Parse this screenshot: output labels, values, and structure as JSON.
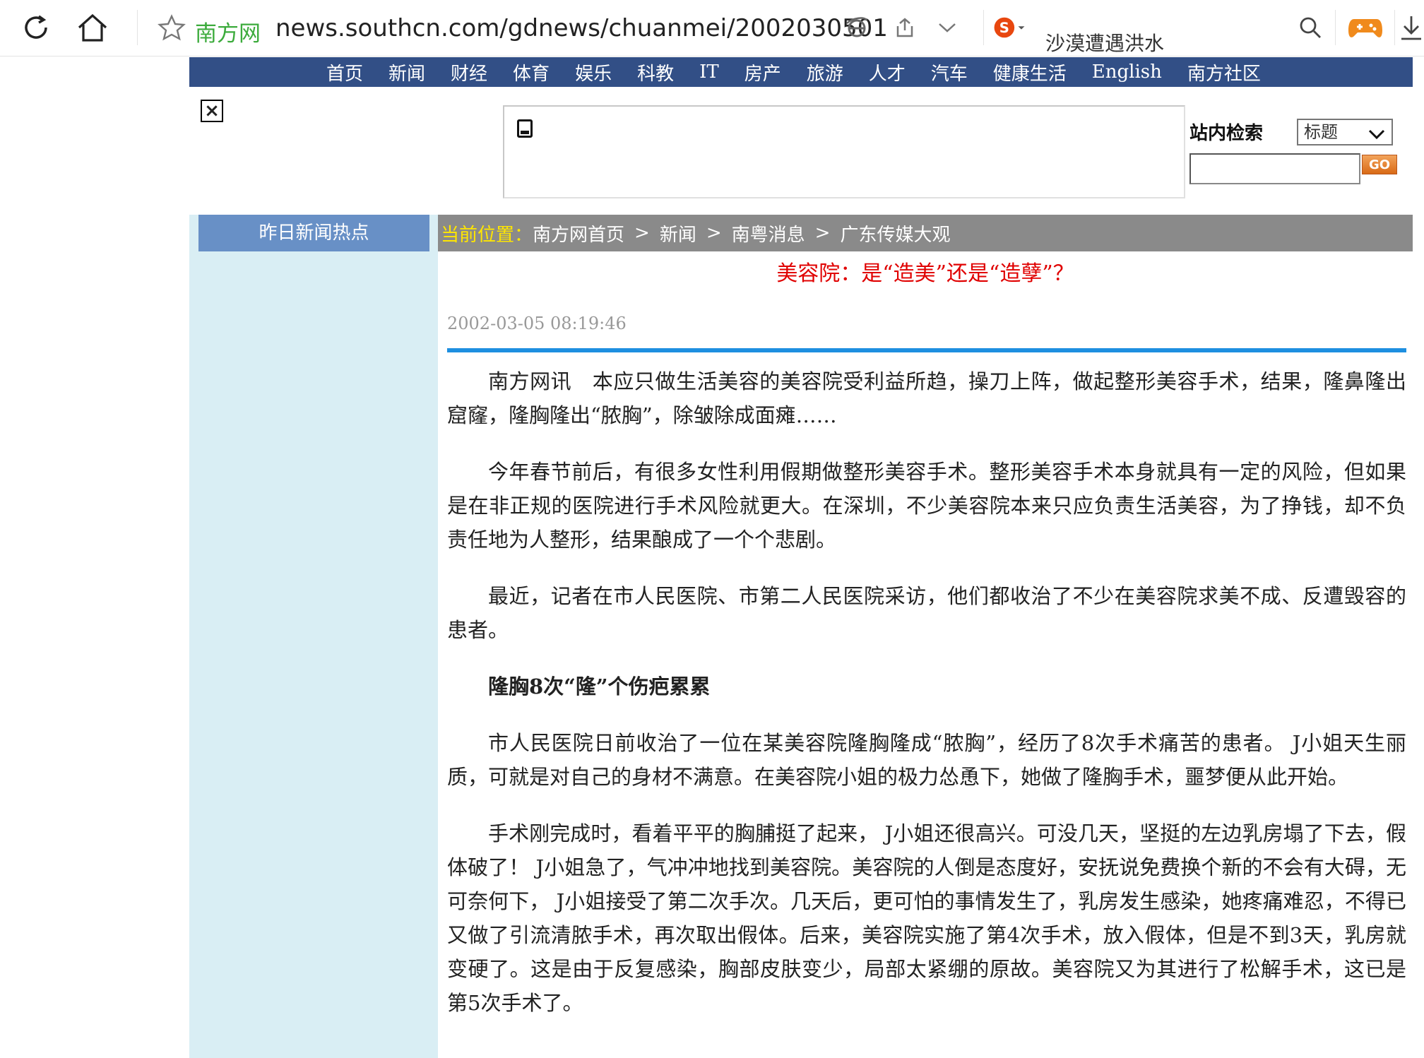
{
  "browser": {
    "site_name": "南方网",
    "url": "news.southcn.com/gdnews/chuanmei/2002030501",
    "search_hint": "沙漠遭遇洪水",
    "icons": [
      "refresh-icon",
      "home-icon",
      "star-icon",
      "ie-mode-icon",
      "share-icon",
      "chevron-down-icon",
      "sogou-icon",
      "search-icon",
      "gamepad-icon",
      "download-icon"
    ]
  },
  "nav": {
    "items": [
      "首页",
      "新闻",
      "财经",
      "体育",
      "娱乐",
      "科教",
      "IT",
      "房产",
      "旅游",
      "人才",
      "汽车",
      "健康生活",
      "English",
      "南方社区"
    ]
  },
  "search": {
    "label": "站内检索",
    "select_value": "标题",
    "go_label": "GO"
  },
  "sidebar": {
    "title": "昨日新闻热点"
  },
  "breadcrumb": {
    "label": "当前位置：",
    "items": [
      "南方网首页",
      "新闻",
      "南粤消息",
      "广东传媒大观"
    ],
    "separator": ">"
  },
  "article": {
    "title": "美容院：是“造美”还是“造孽”？",
    "date": "2002-03-05 08:19:46",
    "paragraphs": [
      "南方网讯　本应只做生活美容的美容院受利益所趋，操刀上阵，做起整形美容手术，结果，隆鼻隆出窟窿，隆胸隆出“脓胸”，除皱除成面瘫……",
      "今年春节前后，有很多女性利用假期做整形美容手术。整形美容手术本身就具有一定的风险，但如果是在非正规的医院进行手术风险就更大。在深圳，不少美容院本来只应负责生活美容，为了挣钱，却不负责任地为人整形，结果酿成了一个个悲剧。",
      "最近，记者在市人民医院、市第二人民医院采访，他们都收治了不少在美容院求美不成、反遭毁容的患者。",
      "隆胸8次“隆”个伤疤累累",
      "市人民医院日前收治了一位在某美容院隆胸隆成“脓胸”，经历了8次手术痛苦的患者。 J小姐天生丽质，可就是对自己的身材不满意。在美容院小姐的极力怂恿下，她做了隆胸手术，噩梦便从此开始。",
      "手术刚完成时，看着平平的胸脯挺了起来， J小姐还很高兴。可没几天，坚挺的左边乳房塌了下去，假体破了！ J小姐急了，气冲冲地找到美容院。美容院的人倒是态度好，安抚说免费换个新的不会有大碍，无可奈何下， J小姐接受了第二次手次。几天后，更可怕的事情发生了，乳房发生感染，她疼痛难忍，不得已又做了引流清脓手术，再次取出假体。后来，美容院实施了第4次手术，放入假体，但是不到3天，乳房就变硬了。这是由于反复感染，胸部皮肤变少，局部太紧绷的原故。美容院又为其进行了松解手术，这已是第5次手术了。"
    ]
  }
}
